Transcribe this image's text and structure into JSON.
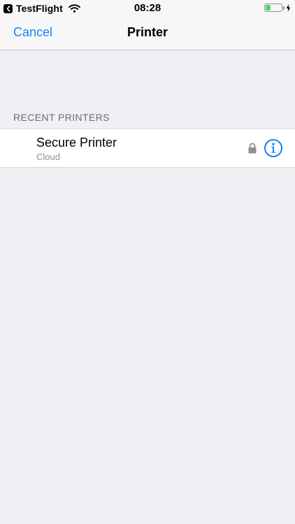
{
  "status_bar": {
    "back_app": "TestFlight",
    "time": "08:28"
  },
  "nav": {
    "cancel_label": "Cancel",
    "title": "Printer"
  },
  "section": {
    "header": "RECENT PRINTERS"
  },
  "printers": [
    {
      "name": "Secure Printer",
      "type": "Cloud"
    }
  ],
  "colors": {
    "accent": "#1a82f6",
    "battery": "#4cd964",
    "background": "#efeff4"
  },
  "battery_level": 0.3
}
